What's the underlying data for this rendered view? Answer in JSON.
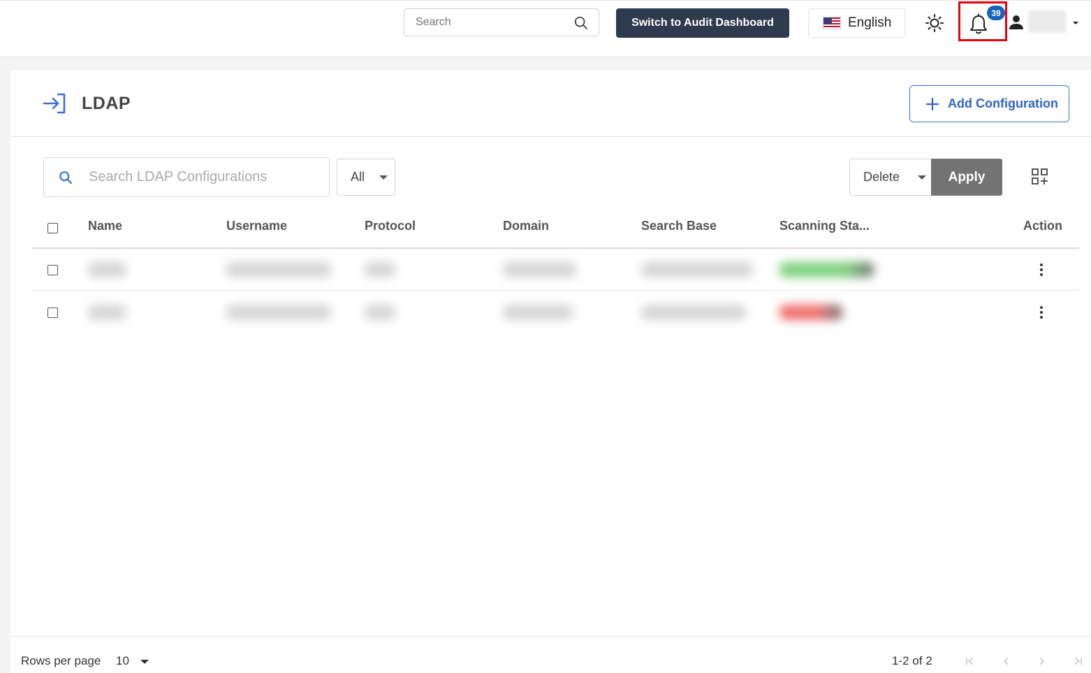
{
  "topbar": {
    "search_placeholder": "Search",
    "audit_button": "Switch to Audit Dashboard",
    "language": "English",
    "notification_count": "39"
  },
  "page": {
    "title": "LDAP",
    "add_button": "Add Configuration"
  },
  "toolbar": {
    "search_placeholder": "Search LDAP Configurations",
    "filter_value": "All",
    "bulk_action": "Delete",
    "apply_label": "Apply"
  },
  "table": {
    "columns": [
      "Name",
      "Username",
      "Protocol",
      "Domain",
      "Search Base",
      "Scanning Sta...",
      "Action"
    ],
    "status_colors": [
      "#7fd17f",
      "#f07070"
    ]
  },
  "footer": {
    "rows_per_page_label": "Rows per page",
    "rows_per_page_value": "10",
    "range": "1-2 of 2"
  },
  "colors": {
    "primary_dark": "#2e3a4e",
    "accent_blue": "#2f63d0",
    "badge_blue": "#1565c0",
    "highlight_red": "#e8000d",
    "apply_gray": "#737373"
  }
}
